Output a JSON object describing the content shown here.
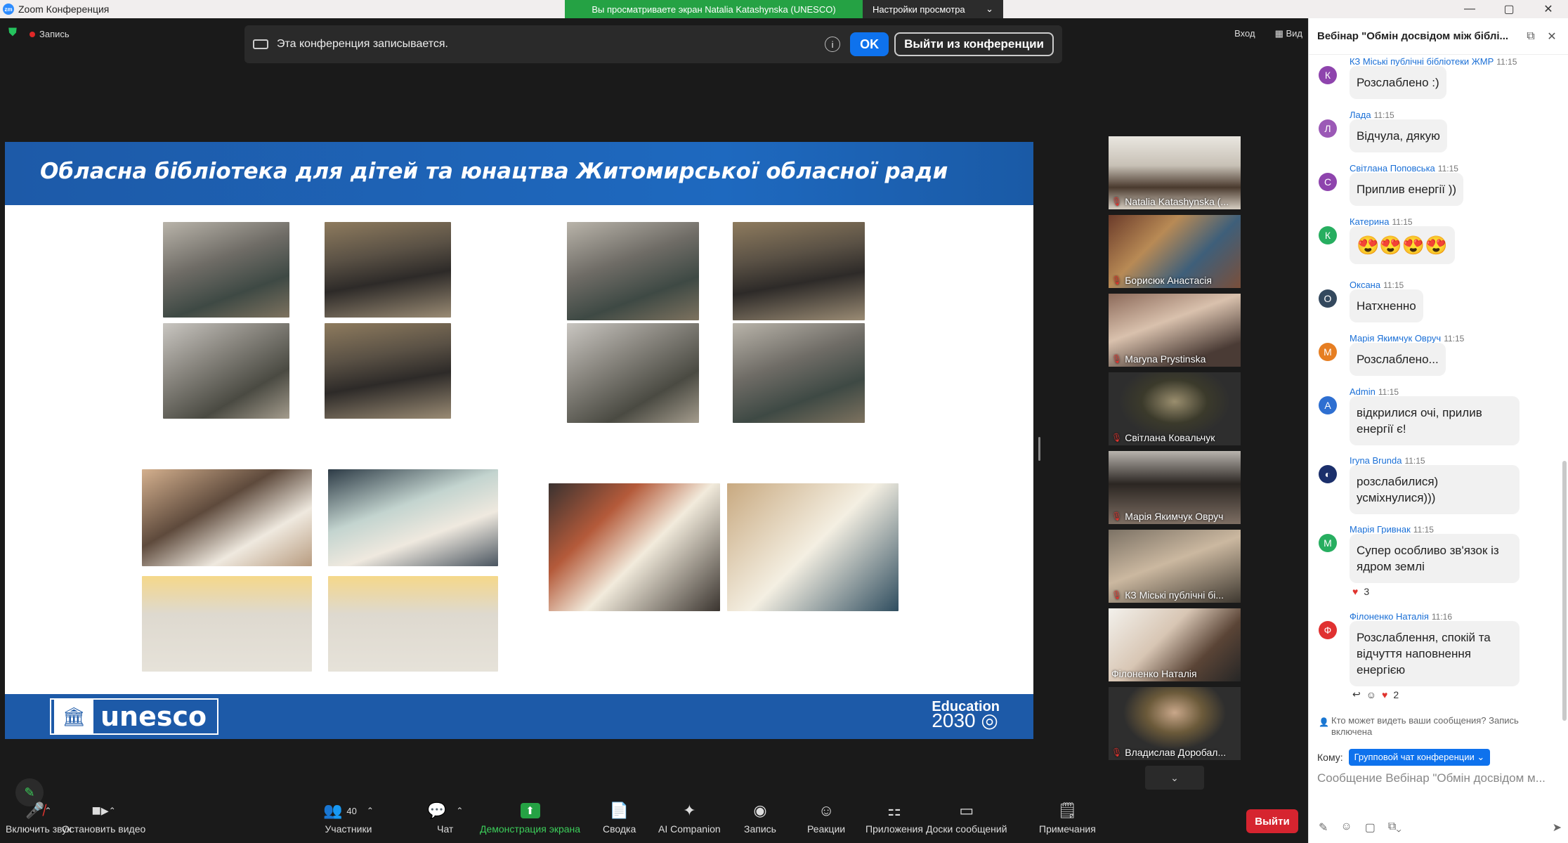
{
  "window": {
    "title": "Zoom Конференция",
    "controls": [
      "—",
      "▢",
      "✕"
    ]
  },
  "share_banner": {
    "text": "Вы просматриваете экран Natalia Katashynska (UNESCO)",
    "view_options": "Настройки просмотра"
  },
  "top_left": {
    "record_label": "Запись"
  },
  "record_notice": {
    "text": "Эта конференция записывается.",
    "ok": "OK",
    "leave": "Выйти из конференции"
  },
  "top_right": {
    "enter": "Вход",
    "view": "Вид"
  },
  "slide": {
    "title": "Обласна бібліотека для дітей та юнацтва Житомирської обласної ради",
    "footer_logo": "unesco",
    "footer_right_1": "Education",
    "footer_right_2": "2030"
  },
  "gallery": [
    {
      "name": "Natalia Katashynska (..."
    },
    {
      "name": "Борисюк Анастасія"
    },
    {
      "name": "Maryna Prystinska"
    },
    {
      "name": "Світлана Ковальчук"
    },
    {
      "name": "Марія Якимчук Овруч"
    },
    {
      "name": "КЗ Міські публічні бі..."
    },
    {
      "name": "Філоненко Наталія"
    },
    {
      "name": "Владислав Доробал..."
    }
  ],
  "toolbar": {
    "unmute": "Включить звук",
    "stop_video": "Остановить видео",
    "participants": "Участники",
    "participants_count": "40",
    "chat": "Чат",
    "share": "Демонстрация экрана",
    "summary": "Сводка",
    "ai": "AI Companion",
    "record": "Запись",
    "reactions": "Реакции",
    "apps": "Приложения",
    "whiteboards": "Доски сообщений",
    "notes": "Примечания",
    "leave": "Выйти"
  },
  "chat": {
    "title": "Вебінар \"Обмін досвідом між біблі...",
    "messages": [
      {
        "initial": "К",
        "color": "#8e44ad",
        "sender": "КЗ Міські публічні бібліотеки ЖМР",
        "time": "11:15",
        "text": "Розслаблено :)"
      },
      {
        "initial": "Л",
        "color": "#9b59b6",
        "sender": "Лада",
        "time": "11:15",
        "text": "Відчула, дякую"
      },
      {
        "initial": "С",
        "color": "#8e44ad",
        "sender": "Світлана Поповська",
        "time": "11:15",
        "text": "Приплив енергії ))"
      },
      {
        "initial": "К",
        "color": "#27ae60",
        "sender": "Катерина",
        "time": "11:15",
        "text": "😍😍😍😍"
      },
      {
        "initial": "О",
        "color": "#34495e",
        "sender": "Оксана",
        "time": "11:15",
        "text": "Натхненно"
      },
      {
        "initial": "М",
        "color": "#e67e22",
        "sender": "Марія Якимчук Овруч",
        "time": "11:15",
        "text": "Розслаблено..."
      },
      {
        "initial": "A",
        "color": "#2e6fd1",
        "sender": "Admin",
        "time": "11:15",
        "text": "відкрилися очі, прилив енергії є!"
      },
      {
        "initial": "",
        "color": "#1b2f6b",
        "sender": "Iryna Brunda",
        "time": "11:15",
        "text": "розслабилися) усміхнулися)))"
      },
      {
        "initial": "М",
        "color": "#27ae60",
        "sender": "Марія Гривнак",
        "time": "11:15",
        "text": "Супер особливо зв'язок із ядром землі",
        "reaction": "3"
      },
      {
        "initial": "Ф",
        "color": "#e03131",
        "sender": "Філоненко Наталія",
        "time": "11:16",
        "text": "Розслаблення, спокій та відчуття наповнення енергією",
        "reaction": "2"
      }
    ],
    "visibility_note": "Кто может видеть ваши сообщения? Запись включена",
    "to_label": "Кому:",
    "to_value": "Групповой чат конференции ⌄",
    "input_placeholder": "Сообщение Вебінар \"Обмін досвідом м..."
  }
}
